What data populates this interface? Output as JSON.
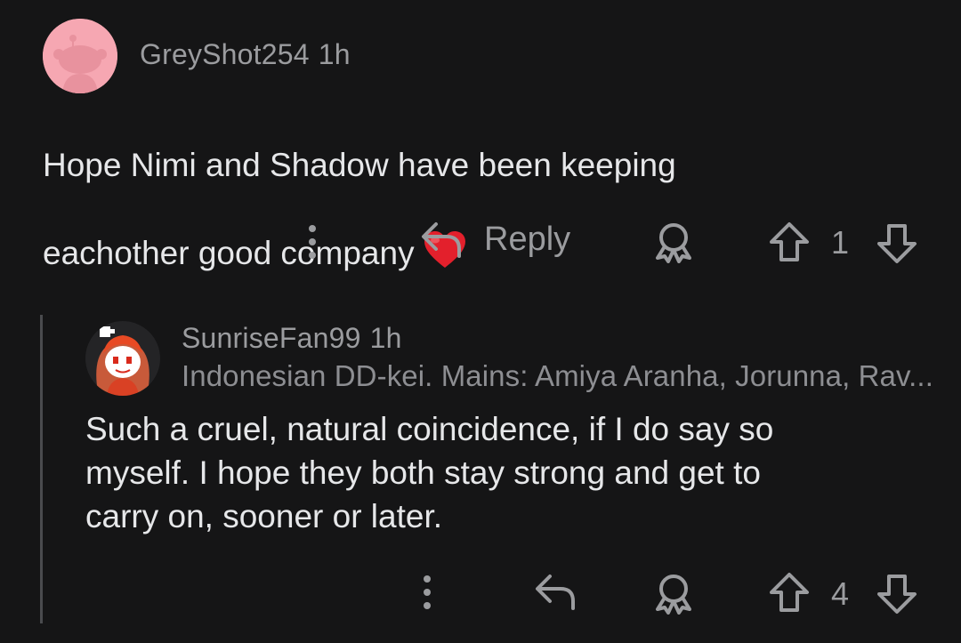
{
  "comment1": {
    "username": "GreyShot254",
    "time": "1h",
    "body_line1": "Hope Nimi and Shadow have been keeping",
    "body_line2": "eachother good company",
    "heart_icon": "red-heart-emoji",
    "actions": {
      "reply_label": "Reply",
      "vote_count": "1"
    }
  },
  "comment2": {
    "username": "SunriseFan99",
    "time": "1h",
    "flair": "Indonesian DD-kei. Mains: Amiya Aranha, Jorunna, Rav...",
    "body": "Such a cruel, natural coincidence, if I do say so\nmyself. I hope they both stay strong and get to\ncarry on, sooner or later.",
    "actions": {
      "vote_count": "4"
    }
  },
  "colors": {
    "background": "#151516",
    "text": "#e6e7e9",
    "muted": "#9b9c9f",
    "avatar1_bg": "#f6a7b2",
    "heart": "#e3202c"
  }
}
